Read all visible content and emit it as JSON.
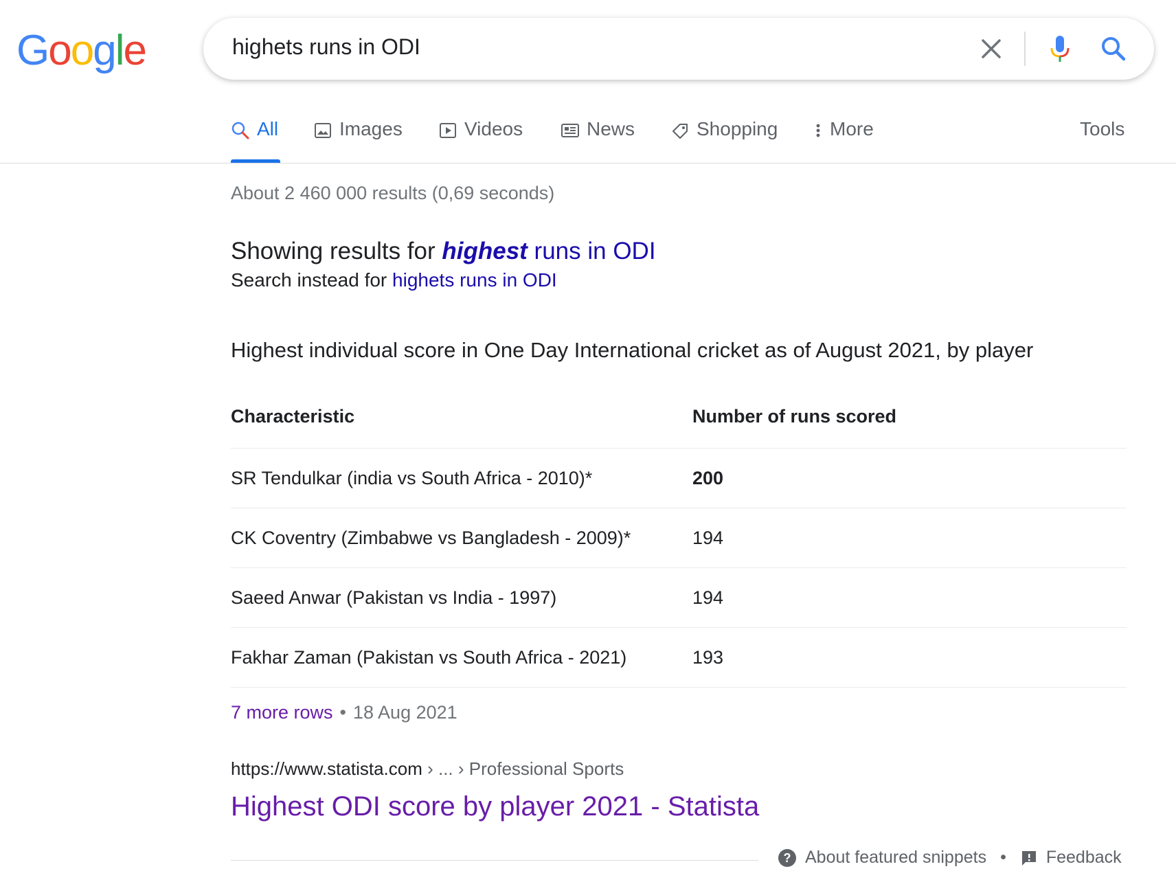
{
  "logo": {
    "letters": [
      "G",
      "o",
      "o",
      "g",
      "l",
      "e"
    ],
    "colors": [
      "#4285F4",
      "#EA4335",
      "#FBBC05",
      "#4285F4",
      "#34A853",
      "#EA4335"
    ]
  },
  "search": {
    "query": "highets runs in ODI"
  },
  "icons": {
    "clear": "close-icon",
    "mic": "microphone-icon",
    "search": "search-icon"
  },
  "tabs": [
    {
      "label": "All",
      "icon": "search-icon",
      "active": true
    },
    {
      "label": "Images",
      "icon": "image-icon"
    },
    {
      "label": "Videos",
      "icon": "video-icon"
    },
    {
      "label": "News",
      "icon": "news-icon"
    },
    {
      "label": "Shopping",
      "icon": "tag-icon"
    },
    {
      "label": "More",
      "icon": "more-vert-icon"
    }
  ],
  "tools_label": "Tools",
  "stats": "About 2 460 000 results (0,69 seconds)",
  "correction": {
    "prefix": "Showing results for ",
    "corrected_word": "highest",
    "rest": " runs in ODI",
    "instead_prefix": "Search instead for ",
    "original_query": "highets runs in ODI"
  },
  "snippet": {
    "heading": "Highest individual score in One Day International cricket as of August 2021, by player",
    "columns": [
      "Characteristic",
      "Number of runs scored"
    ],
    "rows": [
      {
        "characteristic": "SR Tendulkar (india vs South Africa - 2010)*",
        "runs": "200"
      },
      {
        "characteristic": "CK Coventry (Zimbabwe vs Bangladesh - 2009)*",
        "runs": "194"
      },
      {
        "characteristic": "Saeed Anwar (Pakistan vs India - 1997)",
        "runs": "194"
      },
      {
        "characteristic": "Fakhar Zaman (Pakistan vs South Africa - 2021)",
        "runs": "193"
      }
    ],
    "more_rows": "7 more rows",
    "separator": "•",
    "date": "18 Aug 2021"
  },
  "result": {
    "cite_url": "https://www.statista.com",
    "cite_path": " › ... › Professional Sports",
    "title": "Highest ODI score by player 2021 - Statista"
  },
  "footer": {
    "about": "About featured snippets",
    "separator": "•",
    "feedback": "Feedback"
  },
  "colors": {
    "link": "#1a0dab",
    "visited": "#681da8",
    "accent": "#1a73e8",
    "muted": "#70757a"
  }
}
